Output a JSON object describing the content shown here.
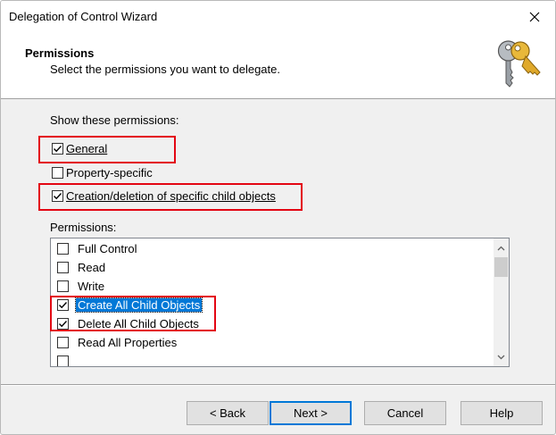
{
  "window": {
    "title": "Delegation of Control Wizard"
  },
  "header": {
    "title": "Permissions",
    "subtitle": "Select the permissions you want to delegate."
  },
  "show_permissions": {
    "label": "Show these permissions:",
    "options": [
      {
        "label": "General",
        "checked": true
      },
      {
        "label": "Property-specific",
        "checked": false
      },
      {
        "label": "Creation/deletion of specific child objects",
        "checked": true
      }
    ]
  },
  "permissions": {
    "label": "Permissions:",
    "items": [
      {
        "label": "Full Control",
        "checked": false
      },
      {
        "label": "Read",
        "checked": false
      },
      {
        "label": "Write",
        "checked": false
      },
      {
        "label": "Create All Child Objects",
        "checked": true,
        "selected": true
      },
      {
        "label": "Delete All Child Objects",
        "checked": true
      },
      {
        "label": "Read All Properties",
        "checked": false
      }
    ]
  },
  "buttons": {
    "back": "< Back",
    "next": "Next >",
    "cancel": "Cancel",
    "help": "Help"
  },
  "colors": {
    "highlight": "#e30613",
    "selection": "#0078d7"
  },
  "icons": {
    "close": "close-icon",
    "keys": "keys-icon",
    "check": "checkmark-icon"
  }
}
